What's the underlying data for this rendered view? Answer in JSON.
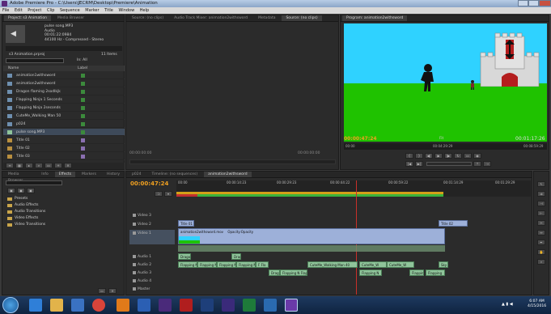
{
  "window": {
    "title": "Adobe Premiere Pro - C:\\Users\\JECRM\\Desktop\\Premiere\\Animation"
  },
  "menu": [
    "File",
    "Edit",
    "Project",
    "Clip",
    "Sequence",
    "Marker",
    "Title",
    "Window",
    "Help"
  ],
  "project_panel": {
    "tabs": [
      "Project: s3 Animation",
      "Media Browser"
    ],
    "preview": {
      "name": "pulse song.MP3",
      "type": "Audio",
      "duration": "00:01:22:0984",
      "rate": "44100 Hz - Compressed - Stereo"
    },
    "project_file": "s3 Animation.prproj",
    "item_count": "11 Items",
    "search_placeholder": "",
    "in_label": "In: All",
    "columns": {
      "name": "Name",
      "label": "Label"
    },
    "items": [
      {
        "name": "animation1withsword",
        "kind": "seq"
      },
      {
        "name": "animation2withsword",
        "kind": "seq"
      },
      {
        "name": "Dragon flaming 2sodlkjk",
        "kind": "seq"
      },
      {
        "name": "Flapping Ninja 1 Seconds",
        "kind": "seq"
      },
      {
        "name": "Flapping Ninja 2seconds",
        "kind": "seq"
      },
      {
        "name": "CuteMe_Walking Man 50",
        "kind": "seq"
      },
      {
        "name": "p024",
        "kind": "seq"
      },
      {
        "name": "pulse song.MP3",
        "kind": "audio"
      },
      {
        "name": "Title 01",
        "kind": "title"
      },
      {
        "name": "Title 02",
        "kind": "title"
      },
      {
        "name": "Title 03",
        "kind": "title"
      }
    ]
  },
  "source_panel": {
    "tabs": [
      "Source: (no clips)",
      "Audio Track Mixer: animation2withsword",
      "Metadata",
      "Source: (no clips)"
    ],
    "timecode_left": "00:00:00:00",
    "timecode_right": "00:00:00:00"
  },
  "program_panel": {
    "tab": "Program: animation2withsword",
    "timecode": "00:00:47:24",
    "fit": "Fit",
    "duration": "00:01:17:26",
    "ruler": [
      "00:00",
      "00:04:29:29",
      "00:08:59:29"
    ]
  },
  "effects_panel": {
    "tabs": [
      "Media Browser",
      "Info",
      "Effects",
      "Markers",
      "History"
    ],
    "folders": [
      "Presets",
      "Audio Effects",
      "Audio Transitions",
      "Video Effects",
      "Video Transitions"
    ]
  },
  "timeline": {
    "tabs": [
      "p024",
      "Timeline: (no sequences)",
      "animation2withsword"
    ],
    "timecode": "00:00:47:24",
    "ruler": [
      "00:00",
      "00:00:14:23",
      "00:00:29:23",
      "00:00:44:22",
      "00:00:59:22",
      "00:01:14:29",
      "00:01:29:29"
    ],
    "video_tracks": [
      "Video 3",
      "Video 2",
      "Video 1"
    ],
    "audio_tracks": [
      "Audio 1",
      "Audio 2",
      "Audio 3",
      "Audio 4",
      "Master"
    ],
    "clips": {
      "v2_a": "Title 01",
      "v2_b": "Title 02",
      "v1_a": "animation2withsword.mov",
      "v1_b": "Opacity:Opacity",
      "a2": [
        "Dragon",
        "Drag"
      ],
      "a3": [
        "Flapping N",
        "Flapping N",
        "Flapping N",
        "Flapping N",
        "Flapping N",
        "F Flo",
        "CuteMe_Walking Man 40",
        "CuteMe_W",
        "CuteMe_W",
        "Sky"
      ],
      "a4": [
        "Drag",
        "Flapping N Flap",
        "Flapping N",
        "Flapping N",
        "Flapping"
      ]
    }
  },
  "taskbar": {
    "time": "6:07 AM",
    "date": "4/15/2016",
    "apps": [
      "ie-icon",
      "explorer-icon",
      "media-icon",
      "chrome-icon",
      "vlc-icon",
      "word-icon",
      "premiere-icon",
      "acrobat-icon",
      "photoshop-icon",
      "aftereffects-icon",
      "excel-icon",
      "app-icon",
      "premiere-active-icon"
    ]
  },
  "colors": {
    "accent": "#e8a33a",
    "green_field": "#1fc200",
    "sky": "#2fd2ff",
    "timecode": "#f0a020"
  }
}
